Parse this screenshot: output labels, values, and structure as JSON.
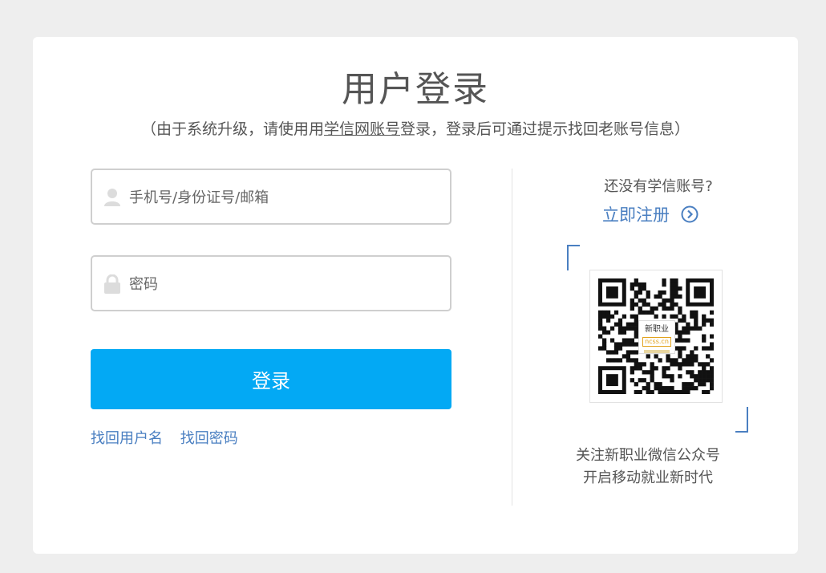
{
  "page": {
    "title": "用户登录",
    "subtitle_prefix": "（由于系统升级，请使用用",
    "subtitle_link": "学信网账号",
    "subtitle_suffix": "登录，登录后可通过提示找回老账号信息）"
  },
  "form": {
    "username_placeholder": "手机号/身份证号/邮箱",
    "password_placeholder": "密码",
    "login_label": "登录",
    "find_username": "找回用户名",
    "find_password": "找回密码"
  },
  "side": {
    "no_account": "还没有学信账号?",
    "register_label": "立即注册",
    "qr_logo_top": "新职业",
    "qr_logo_mid": "ncss.cn",
    "qr_caption_line1": "关注新职业微信公众号",
    "qr_caption_line2": "开启移动就业新时代"
  },
  "colors": {
    "accent_link": "#4a7fc1",
    "login_button": "#03a9f4"
  },
  "icons": {
    "username": "user-icon",
    "password": "lock-icon",
    "register_arrow": "chevron-right-circle-icon"
  }
}
